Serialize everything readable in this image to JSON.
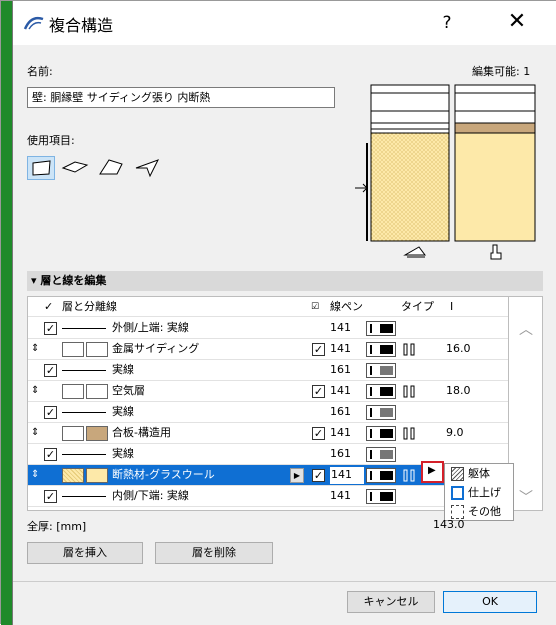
{
  "window": {
    "title": "複合構造",
    "help": "?",
    "close": "✕"
  },
  "name_section": {
    "label": "名前:",
    "value": "壁: 胴縁壁 サイディング張り 内断熱",
    "editable": "編集可能: 1"
  },
  "usage": {
    "label": "使用項目:",
    "items": [
      "wall-icon",
      "slab-icon",
      "roof-icon",
      "shell-icon"
    ]
  },
  "section": {
    "title": "層と線を編集",
    "arrow": "▾"
  },
  "table": {
    "headers": {
      "layer": "層と分離線",
      "pen": "線ペン",
      "type": "タイプ",
      "thickness": "Ⅰ"
    },
    "rows": [
      {
        "kind": "line",
        "label": "外側/上端: 実線",
        "pen": "141"
      },
      {
        "kind": "layer",
        "label": "金属サイディング",
        "pen": "141",
        "thickness": "16.0",
        "color": "#ffffff"
      },
      {
        "kind": "line",
        "label": "実線",
        "pen": "161"
      },
      {
        "kind": "layer",
        "label": "空気層",
        "pen": "141",
        "thickness": "18.0",
        "color": "#ffffff"
      },
      {
        "kind": "line",
        "label": "実線",
        "pen": "161"
      },
      {
        "kind": "layer",
        "label": "合板-構造用",
        "pen": "141",
        "thickness": "9.0",
        "color": "#c8a77c"
      },
      {
        "kind": "line",
        "label": "実線",
        "pen": "161"
      },
      {
        "kind": "layer",
        "label": "断熱材-グラスウール",
        "pen": "141",
        "thickness": "",
        "color": "#fde9a9",
        "selected": true
      },
      {
        "kind": "line",
        "label": "内側/下端: 実線",
        "pen": "141"
      }
    ],
    "scroll_up": "︿",
    "scroll_down": "﹀"
  },
  "popup": {
    "items": [
      "躯体",
      "仕上げ",
      "その他"
    ]
  },
  "total": {
    "label": "全厚: [mm]",
    "value": "143.0"
  },
  "buttons": {
    "insert": "層を挿入",
    "delete": "層を削除",
    "cancel": "キャンセル",
    "ok": "OK"
  },
  "colors": {
    "selection": "#0f6fd3",
    "highlight": "#d4202a",
    "insulation": "#fde9a9",
    "plywood": "#c8a77c"
  }
}
